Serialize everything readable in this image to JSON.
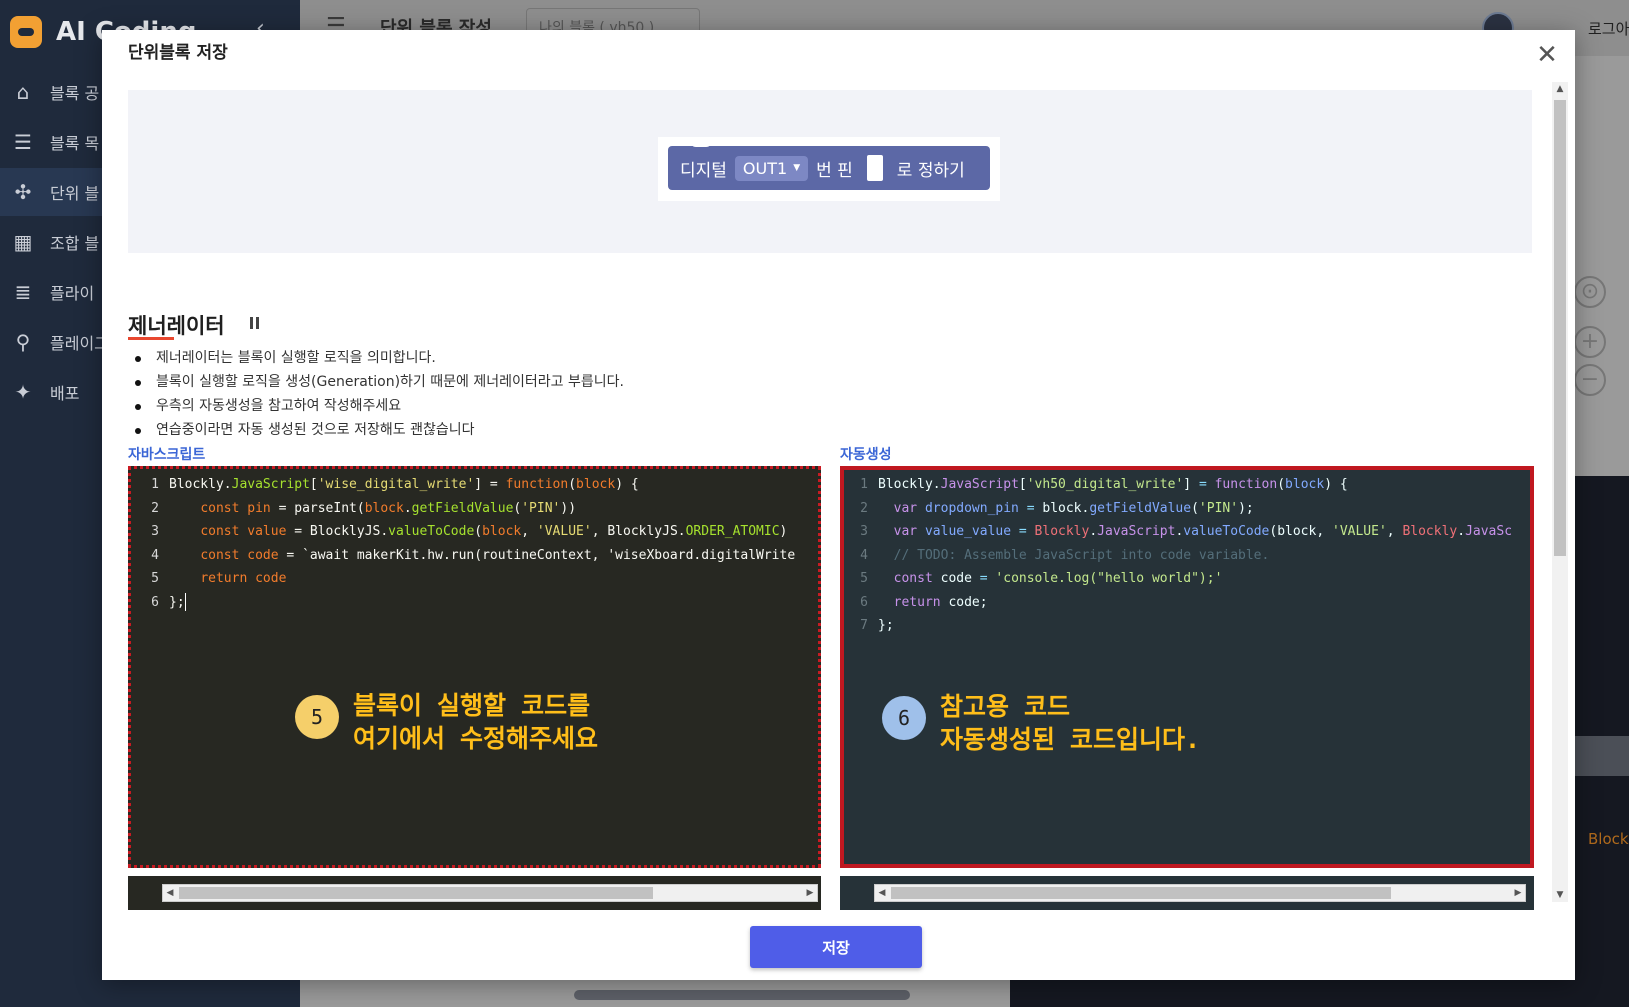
{
  "app": {
    "brand": "AI Coding",
    "header_title": "단위 블록 작성",
    "header_select": "나의 블록 ( vh50 )",
    "login": "로그아",
    "bg_block_text": "Block"
  },
  "sidebar": {
    "items": [
      {
        "label": "블록 공",
        "icon": "home-icon"
      },
      {
        "label": "블록 목",
        "icon": "list-icon"
      },
      {
        "label": "단위 블",
        "icon": "puzzle-icon"
      },
      {
        "label": "조합 블",
        "icon": "grid-icon"
      },
      {
        "label": "플라이",
        "icon": "list-alt-icon"
      },
      {
        "label": "플레이그",
        "icon": "runner-icon"
      },
      {
        "label": "배포",
        "icon": "magic-wand-icon"
      }
    ]
  },
  "modal": {
    "title": "단위블록 저장",
    "close": "✕",
    "block": {
      "prefix": "디지털",
      "dropdown": "OUT1",
      "middle": "번 핀",
      "suffix": "로 정하기",
      "color": "#5c68a6"
    },
    "generator": {
      "heading": "제너레이터",
      "bullets": [
        "제너레이터는 블록이 실행할 로직을 의미합니다.",
        "블록이 실행할 로직을 생성(Generation)하기 때문에 제너레이터라고 부릅니다.",
        "우측의 자동생성을 참고하여 작성해주세요",
        "연습중이라면 자동 생성된 것으로 저장해도 괜찮습니다"
      ]
    },
    "js_pane": {
      "label": "자바스크립트",
      "lines": [
        {
          "n": "1",
          "tokens": [
            [
              "t-def",
              "Blockly."
            ],
            [
              "t-fn",
              "JavaScript"
            ],
            [
              "t-def",
              "["
            ],
            [
              "t-str",
              "'wise_digital_write'"
            ],
            [
              "t-def",
              "] = "
            ],
            [
              "t-kw",
              "function"
            ],
            [
              "t-def",
              "("
            ],
            [
              "t-kw",
              "block"
            ],
            [
              "t-def",
              ") {"
            ]
          ]
        },
        {
          "n": "2",
          "tokens": [
            [
              "t-def",
              "    "
            ],
            [
              "t-kw",
              "const"
            ],
            [
              "t-def",
              " "
            ],
            [
              "t-kw",
              "pin"
            ],
            [
              "t-def",
              " = parseInt("
            ],
            [
              "t-kw",
              "block"
            ],
            [
              "t-def",
              "."
            ],
            [
              "t-fn",
              "getFieldValue"
            ],
            [
              "t-def",
              "("
            ],
            [
              "t-str",
              "'PIN'"
            ],
            [
              "t-def",
              "))"
            ]
          ]
        },
        {
          "n": "3",
          "tokens": [
            [
              "t-def",
              "    "
            ],
            [
              "t-kw",
              "const"
            ],
            [
              "t-def",
              " "
            ],
            [
              "t-kw",
              "value"
            ],
            [
              "t-def",
              " = BlocklyJS."
            ],
            [
              "t-fn",
              "valueToCode"
            ],
            [
              "t-def",
              "("
            ],
            [
              "t-kw",
              "block"
            ],
            [
              "t-def",
              ", "
            ],
            [
              "t-str",
              "'VALUE'"
            ],
            [
              "t-def",
              ", BlocklyJS."
            ],
            [
              "t-fn",
              "ORDER_ATOMIC"
            ],
            [
              "t-def",
              ")"
            ]
          ]
        },
        {
          "n": "4",
          "tokens": [
            [
              "t-def",
              "    "
            ],
            [
              "t-kw",
              "const"
            ],
            [
              "t-def",
              " "
            ],
            [
              "t-kw",
              "code"
            ],
            [
              "t-def",
              " = `await makerKit.hw.run(routineContext, 'wiseXboard.digitalWrite"
            ]
          ]
        },
        {
          "n": "5",
          "tokens": [
            [
              "t-def",
              "    "
            ],
            [
              "t-kw",
              "return"
            ],
            [
              "t-def",
              " "
            ],
            [
              "t-kw",
              "code"
            ]
          ]
        },
        {
          "n": "6",
          "tokens": [
            [
              "t-def",
              "};"
            ]
          ]
        }
      ],
      "callout_num": "5",
      "callout_line1": "블록이 실행할 코드를",
      "callout_line2": "여기에서 수정해주세요"
    },
    "auto_pane": {
      "label": "자동생성",
      "lines": [
        {
          "n": "1",
          "tokens": [
            [
              "a-def",
              "Blockly."
            ],
            [
              "a-prop",
              "JavaScript"
            ],
            [
              "a-def",
              "["
            ],
            [
              "a-str",
              "'vh50_digital_write'"
            ],
            [
              "a-def",
              "] "
            ],
            [
              "a-op",
              "="
            ],
            [
              "a-def",
              " "
            ],
            [
              "a-prop",
              "function"
            ],
            [
              "a-def",
              "("
            ],
            [
              "a-kw",
              "block"
            ],
            [
              "a-def",
              ") {"
            ]
          ]
        },
        {
          "n": "2",
          "tokens": [
            [
              "a-def",
              "  "
            ],
            [
              "a-prop",
              "var"
            ],
            [
              "a-def",
              " "
            ],
            [
              "a-kw",
              "dropdown_pin"
            ],
            [
              "a-def",
              " "
            ],
            [
              "a-op",
              "="
            ],
            [
              "a-def",
              " block."
            ],
            [
              "a-kw",
              "getFieldValue"
            ],
            [
              "a-def",
              "("
            ],
            [
              "a-str",
              "'PIN'"
            ],
            [
              "a-def",
              ");"
            ]
          ]
        },
        {
          "n": "3",
          "tokens": [
            [
              "a-def",
              "  "
            ],
            [
              "a-prop",
              "var"
            ],
            [
              "a-def",
              " "
            ],
            [
              "a-kw",
              "value_value"
            ],
            [
              "a-def",
              " "
            ],
            [
              "a-op",
              "="
            ],
            [
              "a-def",
              " "
            ],
            [
              "a-var",
              "Blockly"
            ],
            [
              "a-def",
              "."
            ],
            [
              "a-prop",
              "JavaScript"
            ],
            [
              "a-def",
              "."
            ],
            [
              "a-kw",
              "valueToCode"
            ],
            [
              "a-def",
              "(block, "
            ],
            [
              "a-str",
              "'VALUE'"
            ],
            [
              "a-def",
              ", "
            ],
            [
              "a-var",
              "Blockly"
            ],
            [
              "a-def",
              "."
            ],
            [
              "a-prop",
              "JavaSc"
            ]
          ]
        },
        {
          "n": "4",
          "tokens": [
            [
              "a-com",
              "  // TODO: Assemble JavaScript into code variable."
            ]
          ]
        },
        {
          "n": "5",
          "tokens": [
            [
              "a-def",
              "  "
            ],
            [
              "a-prop",
              "const"
            ],
            [
              "a-def",
              " code "
            ],
            [
              "a-op",
              "="
            ],
            [
              "a-def",
              " "
            ],
            [
              "a-str",
              "'console.log(\"hello world\");'"
            ]
          ]
        },
        {
          "n": "6",
          "tokens": [
            [
              "a-def",
              "  "
            ],
            [
              "a-prop",
              "return"
            ],
            [
              "a-def",
              " code;"
            ]
          ]
        },
        {
          "n": "7",
          "tokens": [
            [
              "a-def",
              "};"
            ]
          ]
        }
      ],
      "callout_num": "6",
      "callout_line1": "참고용 코드",
      "callout_line2": "자동생성된 코드입니다."
    },
    "save_label": "저장"
  }
}
